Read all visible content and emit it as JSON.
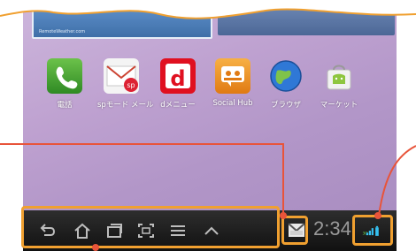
{
  "colors": {
    "accent_orange": "#f0a030",
    "callout_red": "#e8543a",
    "navbar_bg": "#1a1a1a"
  },
  "widgets": {
    "left_text": "RemoteWeather.com"
  },
  "apps": [
    {
      "label": "電話",
      "icon": "phone-icon"
    },
    {
      "label": "spモード メール",
      "icon": "mail-icon"
    },
    {
      "label": "dメニュー",
      "icon": "d-menu-icon"
    },
    {
      "label": "Social Hub",
      "icon": "social-hub-icon"
    },
    {
      "label": "ブラウザ",
      "icon": "browser-globe-icon"
    },
    {
      "label": "マーケット",
      "icon": "market-icon"
    }
  ],
  "navbar": {
    "clock": "2:34",
    "icons": [
      "back-icon",
      "home-icon",
      "recent-apps-icon",
      "screenshot-icon",
      "menu-icon",
      "up-chevron-icon"
    ],
    "notification": "email-notification-icon",
    "status": "3g-signal-battery-icon"
  }
}
